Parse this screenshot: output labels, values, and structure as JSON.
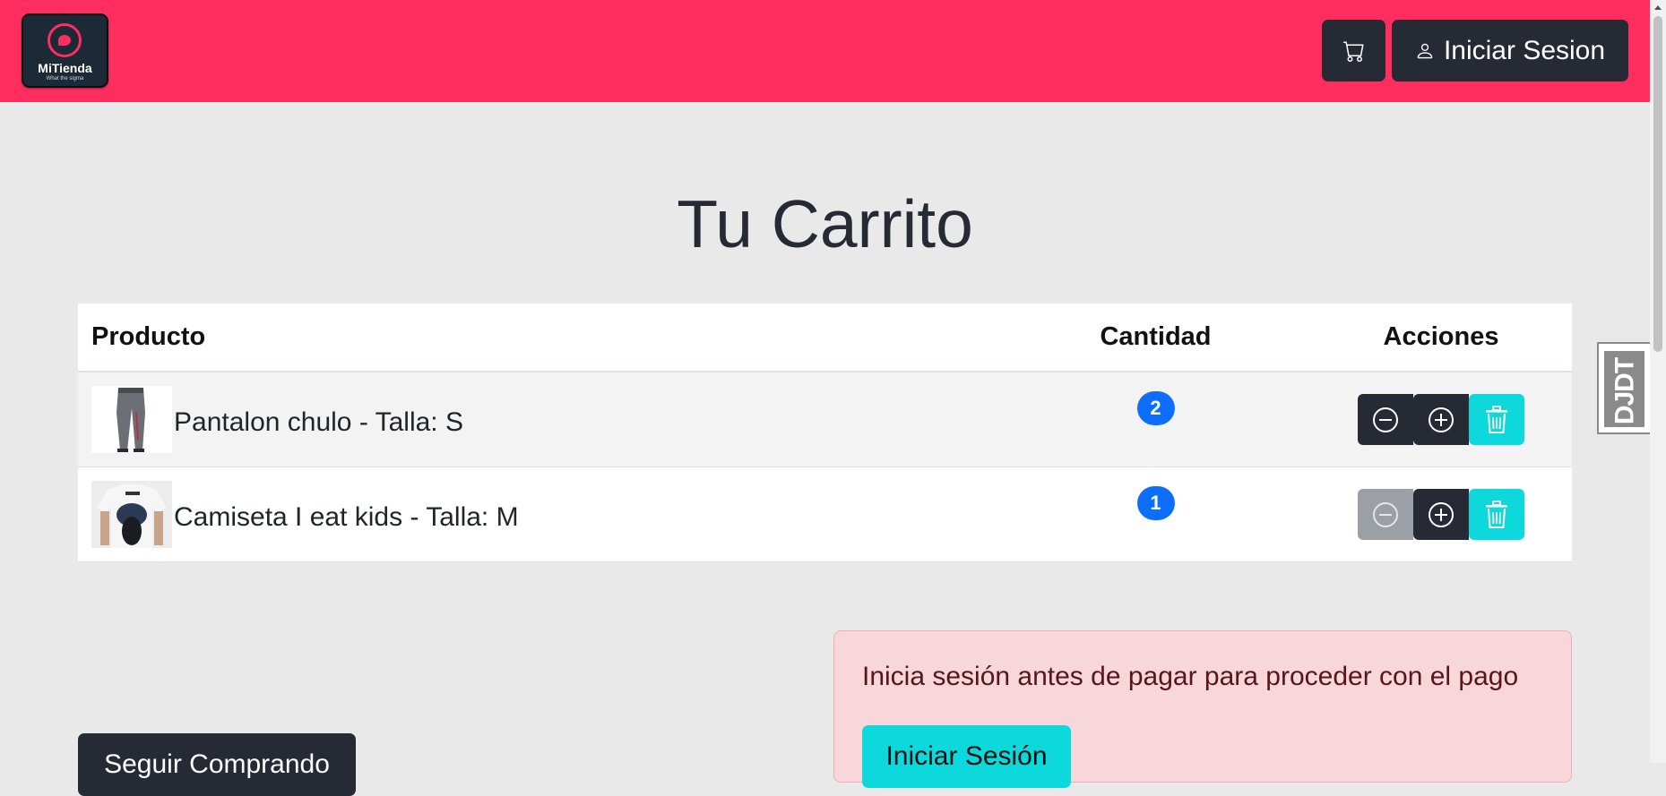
{
  "header": {
    "brand_name": "MiTienda",
    "brand_tagline": "What the sigma",
    "cart_icon": "cart-icon",
    "login_label": "Iniciar Sesion",
    "login_icon": "person-icon"
  },
  "page": {
    "title": "Tu Carrito"
  },
  "table": {
    "columns": [
      "Producto",
      "Cantidad",
      "Acciones"
    ],
    "rows": [
      {
        "product": "Pantalon chulo - Talla: S",
        "quantity": "2",
        "image": "pants-thumbnail",
        "decrease_enabled": true
      },
      {
        "product": "Camiseta I eat kids - Talla: M",
        "quantity": "1",
        "image": "tshirt-thumbnail",
        "decrease_enabled": false
      }
    ],
    "action_icons": [
      "minus-circle-icon",
      "plus-circle-icon",
      "trash-icon"
    ]
  },
  "checkout": {
    "alert_text": "Inicia sesión antes de pagar para proceder con el pago",
    "login_button": "Iniciar Sesión",
    "continue_button": "Seguir Comprando"
  },
  "debug_toolbar": {
    "label": "DJDT"
  },
  "colors": {
    "navbar": "#ff2e5f",
    "dark_button": "#252a35",
    "badge": "#0d6efd",
    "cyan_button": "#0dd9dc",
    "alert_bg": "#f8d7da"
  }
}
